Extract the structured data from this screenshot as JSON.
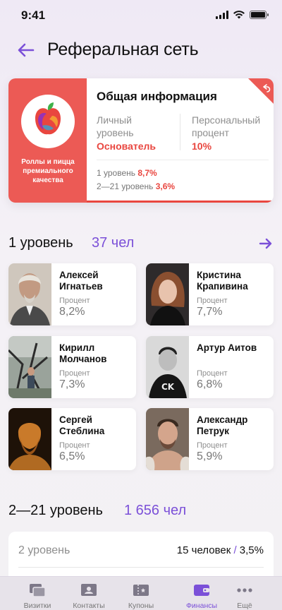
{
  "status": {
    "time": "9:41"
  },
  "header": {
    "title": "Реферальная сеть"
  },
  "info": {
    "brand_caption": "Роллы и пицца премиального качества",
    "title": "Общая информация",
    "personal_level_label": "Личный уровень",
    "personal_level_value": "Основатель",
    "personal_percent_label": "Персональный процент",
    "personal_percent_value": "10%",
    "level1_label": "1 уровень",
    "level1_value": "8,7%",
    "levels_label": "2—21 уровень",
    "levels_value": "3,6%"
  },
  "section1": {
    "title": "1 уровень",
    "count": "37 чел"
  },
  "people": [
    {
      "name": "Алексей Игнатьев",
      "label": "Процент",
      "value": "8,2%"
    },
    {
      "name": "Кристина Крапивина",
      "label": "Процент",
      "value": "7,7%"
    },
    {
      "name": "Кирилл Молчанов",
      "label": "Процент",
      "value": "7,3%"
    },
    {
      "name": "Артур Аитов",
      "label": "Процент",
      "value": "6,8%"
    },
    {
      "name": "Сергей Стеблина",
      "label": "Процент",
      "value": "6,5%"
    },
    {
      "name": "Александр Петрук",
      "label": "Процент",
      "value": "5,9%"
    }
  ],
  "section2": {
    "title": "2—21 уровень",
    "count": "1 656 чел"
  },
  "level_rows": [
    {
      "label": "2 уровень",
      "people": "15 человек",
      "separator": "/",
      "percent": "3,5%"
    }
  ],
  "tabs": [
    {
      "label": "Визитки",
      "icon": "cards-icon"
    },
    {
      "label": "Контакты",
      "icon": "contact-card-icon"
    },
    {
      "label": "Купоны",
      "icon": "coupon-icon"
    },
    {
      "label": "Финансы",
      "icon": "wallet-icon"
    },
    {
      "label": "Ещё",
      "icon": "more-dots-icon"
    }
  ],
  "colors": {
    "accent": "#7b50d8",
    "brand_red": "#ec5a55",
    "value_red": "#e9463f"
  }
}
